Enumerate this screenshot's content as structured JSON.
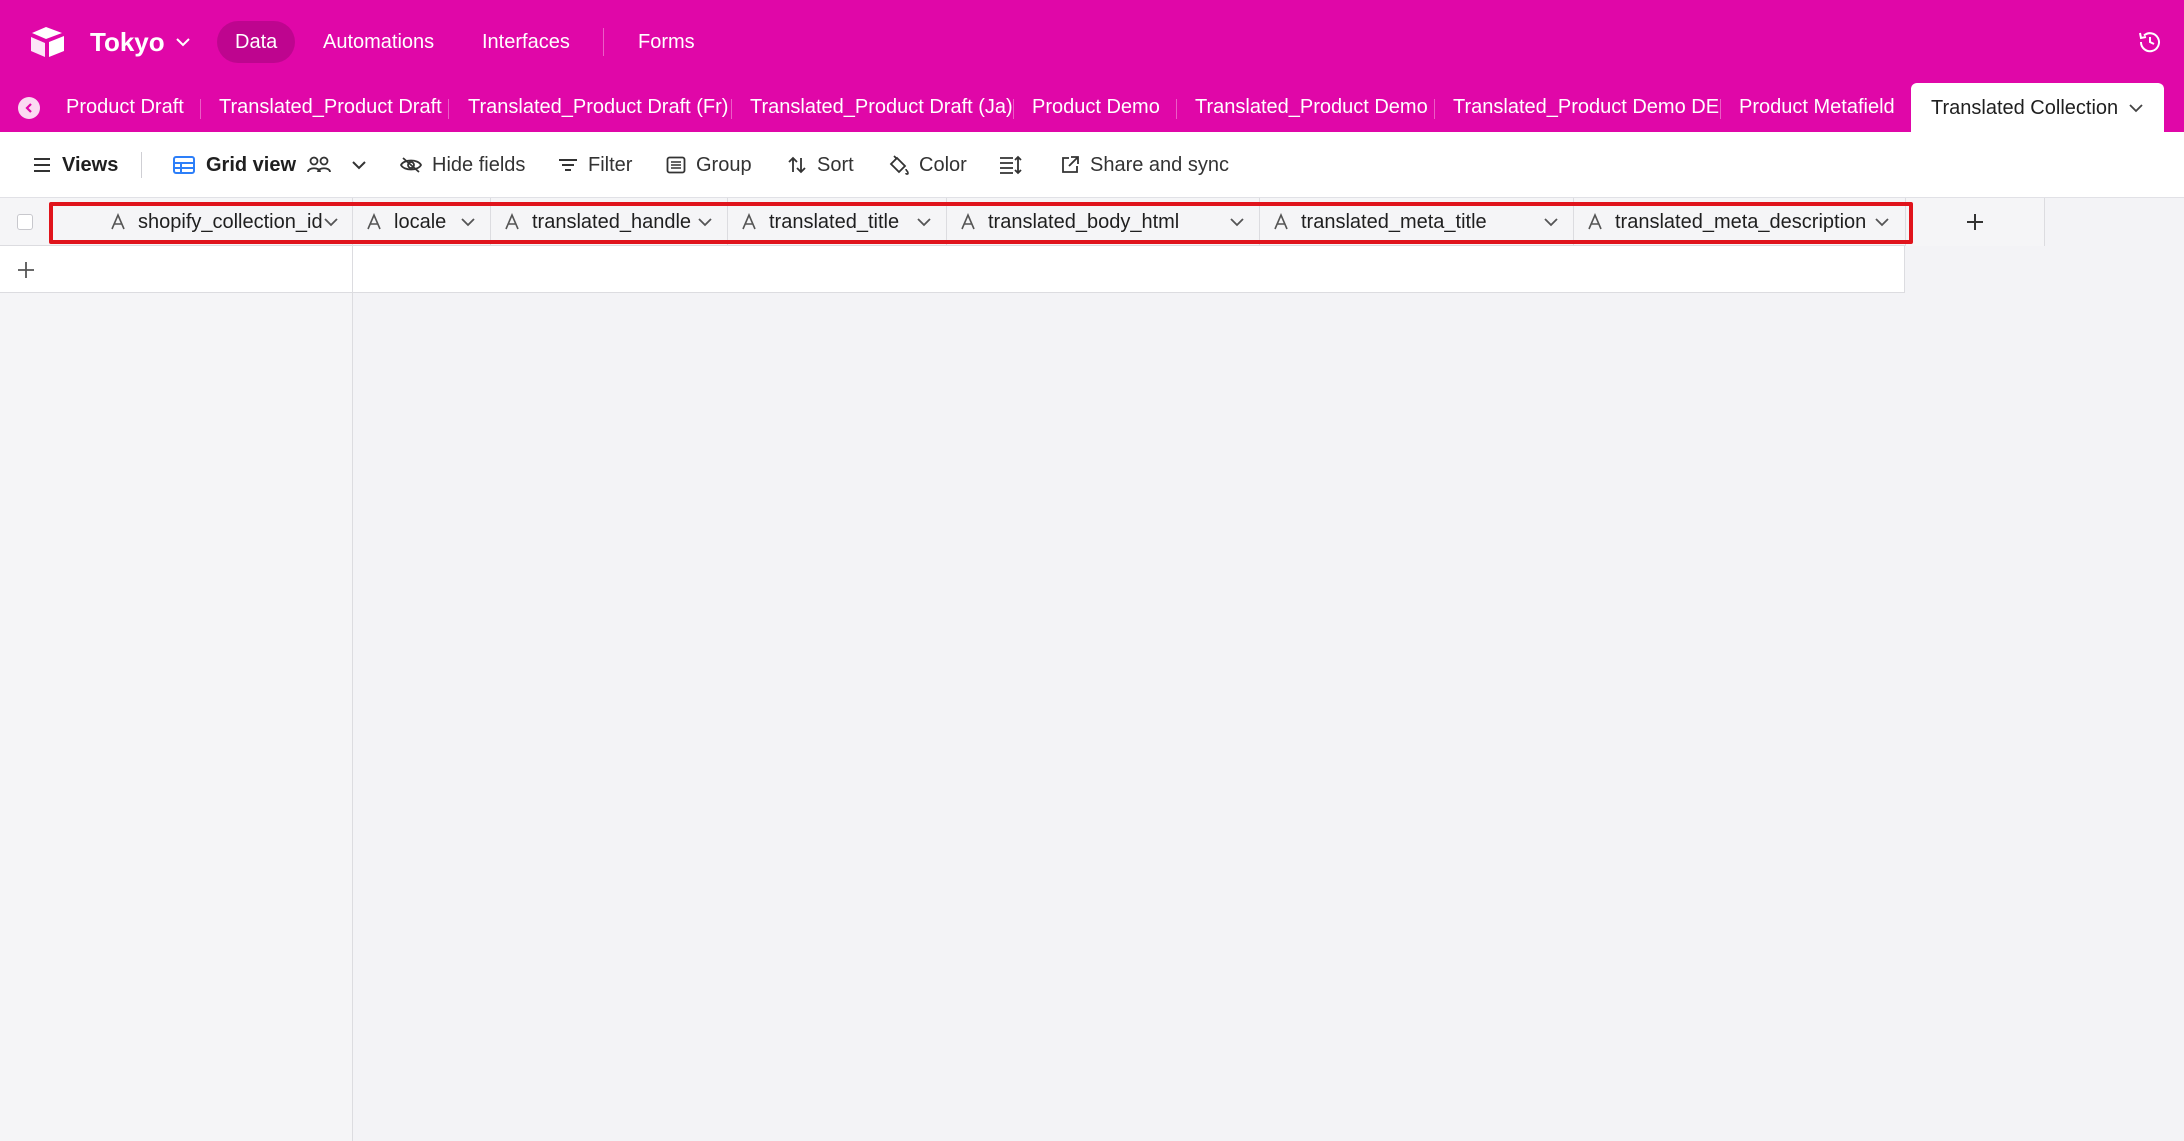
{
  "colors": {
    "brand": "#e007a8",
    "highlight": "#e0141c"
  },
  "topbar": {
    "base_name": "Tokyo",
    "nav": [
      "Data",
      "Automations",
      "Interfaces",
      "Forms"
    ],
    "active_nav": "Data"
  },
  "tables": {
    "tabs": [
      "Product Draft",
      "Translated_Product Draft",
      "Translated_Product Draft (Fr)",
      "Translated_Product Draft (Ja)",
      "Product Demo",
      "Translated_Product Demo",
      "Translated_Product Demo DE",
      "Product Metafield"
    ],
    "active_tab": "Translated Collection"
  },
  "viewbar": {
    "views_label": "Views",
    "view_name": "Grid view",
    "hide_fields": "Hide fields",
    "filter": "Filter",
    "group": "Group",
    "sort": "Sort",
    "color": "Color",
    "share": "Share and sync"
  },
  "grid": {
    "columns": [
      {
        "name": "shopify_collection_id",
        "type_icon": "text-field-icon"
      },
      {
        "name": "locale",
        "type_icon": "text-field-icon"
      },
      {
        "name": "translated_handle",
        "type_icon": "text-field-icon"
      },
      {
        "name": "translated_title",
        "type_icon": "text-field-icon"
      },
      {
        "name": "translated_body_html",
        "type_icon": "text-field-icon"
      },
      {
        "name": "translated_meta_title",
        "type_icon": "text-field-icon"
      },
      {
        "name": "translated_meta_description",
        "type_icon": "text-field-icon"
      }
    ],
    "rows": []
  }
}
